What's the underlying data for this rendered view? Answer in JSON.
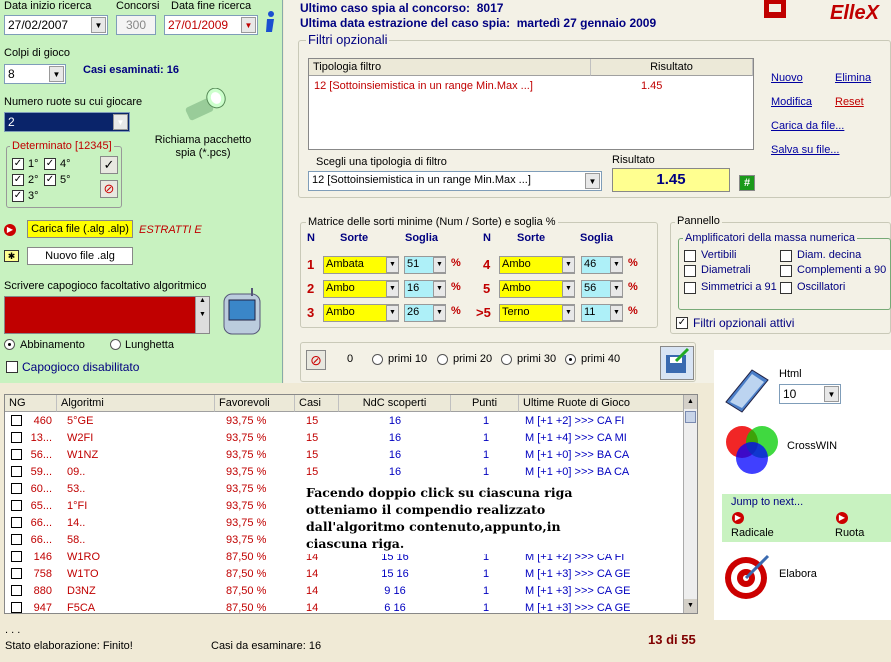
{
  "header": {
    "date_start_label": "Data inizio ricerca",
    "contests_label": "Concorsi",
    "date_end_label": "Data fine ricerca",
    "date_start": "27/02/2007",
    "contests": "300",
    "date_end": "27/01/2009",
    "last_case_label": "Ultimo caso spia al concorso:",
    "last_case_value": "8017",
    "last_date_label": "Ultima data estrazione del caso spia:",
    "last_date_value": "martedì 27 gennaio 2009",
    "brand": "ElleX"
  },
  "left": {
    "colpi_label": "Colpi di gioco",
    "colpi_value": "8",
    "casi_label": "Casi esaminati: 16",
    "ruote_label": "Numero ruote su cui giocare",
    "ruote_value": "2",
    "determinato_label": "Determinato [12345]",
    "det_items": [
      "1°",
      "4°",
      "2°",
      "5°",
      "3°"
    ],
    "richiama_label": "Richiama pacchetto spia (*.pcs)",
    "carica_button": "Carica file  (.alg .alp)",
    "estratti_label": "ESTRATTI E",
    "nuovo_file_button": "Nuovo file .alg",
    "capogioco_label": "Scrivere capogioco facoltativo algoritmico",
    "abbinamento_label": "Abbinamento",
    "lunghetta_label": "Lunghetta",
    "capogioco_disabled_label": "Capogioco disabilitato"
  },
  "filters": {
    "title": "Filtri opzionali",
    "col_tipologia": "Tipologia filtro",
    "col_risultato": "Risultato",
    "row_tipologia": "12 [Sottoinsiemistica in un range Min.Max ...]",
    "row_risultato": "1.45",
    "scegli_label": "Scegli una tipologia di filtro",
    "scegli_value": "12 [Sottoinsiemistica in un range Min.Max ...]",
    "risultato_label": "Risultato",
    "risultato_value": "1.45",
    "hash_button": "#",
    "links": {
      "nuovo": "Nuovo",
      "elimina": "Elimina",
      "modifica": "Modifica",
      "reset": "Reset",
      "carica": "Carica da file...",
      "salva": "Salva su file..."
    }
  },
  "matrix": {
    "title": "Matrice delle sorti minime (Num / Sorte) e soglia %",
    "col_n": "N",
    "col_sorte": "Sorte",
    "col_soglia": "Soglia",
    "rows": [
      {
        "n": "1",
        "sorte": "Ambata",
        "soglia": "51",
        "pct": "%"
      },
      {
        "n": "2",
        "sorte": "Ambo",
        "soglia": "16",
        "pct": "%"
      },
      {
        "n": "3",
        "sorte": "Ambo",
        "soglia": "26",
        "pct": "%"
      },
      {
        "n": "4",
        "sorte": "Ambo",
        "soglia": "46",
        "pct": "%"
      },
      {
        "n": "5",
        "sorte": "Ambo",
        "soglia": "56",
        "pct": "%"
      },
      {
        "n": ">5",
        "sorte": "Terno",
        "soglia": "11",
        "pct": "%"
      }
    ]
  },
  "pannello": {
    "title": "Pannello",
    "ampl_title": "Amplificatori della massa numerica",
    "items": [
      "Vertibili",
      "Diam. decina",
      "Diametrali",
      "Complementi a 90",
      "Simmetrici a 91",
      "Oscillatori"
    ],
    "filtri_attivi": "Filtri opzionali attivi"
  },
  "primi": {
    "zero": "0",
    "options": [
      "primi 10",
      "primi 20",
      "primi 30",
      "primi 40"
    ]
  },
  "grid": {
    "headers": [
      "NG",
      "Algoritmi",
      "Favorevoli",
      "Casi",
      "NdC scoperti",
      "Punti",
      "Ultime Ruote di Gioco"
    ],
    "rows": [
      {
        "ng": "460",
        "alg": "5°GE",
        "fav": "93,75 %",
        "casi": "15",
        "ndc": "16",
        "pt": "1",
        "ult": "M [+1 +2] >>> CA FI"
      },
      {
        "ng": "13...",
        "alg": "W2FI",
        "fav": "93,75 %",
        "casi": "15",
        "ndc": "16",
        "pt": "1",
        "ult": "M [+1 +4] >>> CA MI"
      },
      {
        "ng": "56...",
        "alg": "W1NZ",
        "fav": "93,75 %",
        "casi": "15",
        "ndc": "16",
        "pt": "1",
        "ult": "M [+1 +0] >>> BA CA"
      },
      {
        "ng": "59...",
        "alg": "09..",
        "fav": "93,75 %",
        "casi": "15",
        "ndc": "16",
        "pt": "1",
        "ult": "M [+1 +0] >>> BA CA"
      },
      {
        "ng": "60...",
        "alg": "53..",
        "fav": "93,75 %",
        "casi": "",
        "ndc": "",
        "pt": "",
        "ult": ""
      },
      {
        "ng": "65...",
        "alg": "1°FI",
        "fav": "93,75 %",
        "casi": "",
        "ndc": "",
        "pt": "",
        "ult": ""
      },
      {
        "ng": "66...",
        "alg": "14..",
        "fav": "93,75 %",
        "casi": "",
        "ndc": "",
        "pt": "",
        "ult": ""
      },
      {
        "ng": "66...",
        "alg": "58..",
        "fav": "93,75 %",
        "casi": "",
        "ndc": "",
        "pt": "",
        "ult": ""
      },
      {
        "ng": "146",
        "alg": "W1RO",
        "fav": "87,50 %",
        "casi": "14",
        "ndc": "15 16",
        "pt": "1",
        "ult": "M [+1 +2] >>> CA FI"
      },
      {
        "ng": "758",
        "alg": "W1TO",
        "fav": "87,50 %",
        "casi": "14",
        "ndc": "15 16",
        "pt": "1",
        "ult": "M [+1 +3] >>> CA GE"
      },
      {
        "ng": "880",
        "alg": "D3NZ",
        "fav": "87,50 %",
        "casi": "14",
        "ndc": "9 16",
        "pt": "1",
        "ult": "M [+1 +3] >>> CA GE"
      },
      {
        "ng": "947",
        "alg": "F5CA",
        "fav": "87,50 %",
        "casi": "14",
        "ndc": "6 16",
        "pt": "1",
        "ult": "M [+1 +3] >>> CA GE"
      }
    ],
    "overlay_text": "Facendo doppio click su ciascuna riga otteniamo il compendio realizzato dall'algoritmo contenuto,appunto,in ciascuna riga."
  },
  "right_panel": {
    "html_label": "Html",
    "html_value": "10",
    "crosswin_label": "CrossWIN",
    "jump_title": "Jump to next...",
    "radicale": "Radicale",
    "ruota": "Ruota",
    "elabora": "Elabora"
  },
  "status": {
    "dots": ". . .",
    "stato": "Stato elaborazione: Finito!",
    "casi": "Casi da esaminare: 16",
    "page": "13 di 55"
  }
}
